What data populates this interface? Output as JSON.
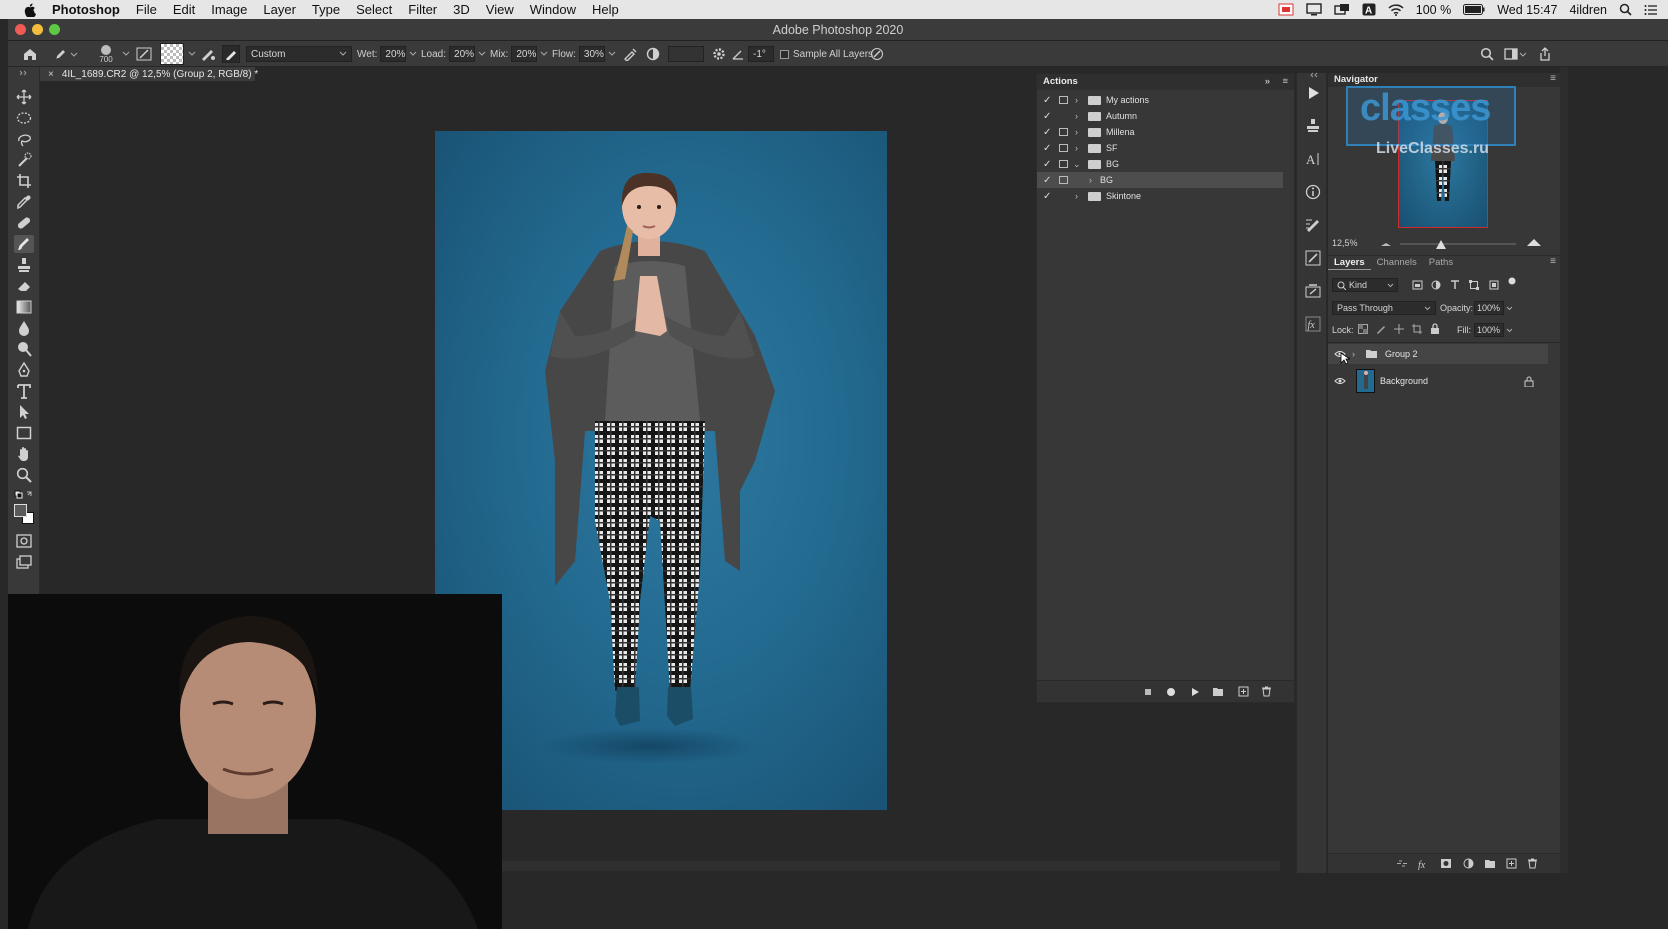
{
  "menubar": {
    "app": "Photoshop",
    "items": [
      "File",
      "Edit",
      "Image",
      "Layer",
      "Type",
      "Select",
      "Filter",
      "3D",
      "View",
      "Window",
      "Help"
    ],
    "battery": "100 %",
    "clock": "Wed 15:47",
    "user": "4ildren"
  },
  "window": {
    "title": "Adobe Photoshop 2020"
  },
  "options": {
    "brush_size": "700",
    "preset": "Custom",
    "wet_label": "Wet:",
    "wet": "20%",
    "load_label": "Load:",
    "load": "20%",
    "mix_label": "Mix:",
    "mix": "20%",
    "flow_label": "Flow:",
    "flow": "30%",
    "angle": "-1°",
    "sample_all_layers": "Sample All Layers"
  },
  "document": {
    "tab": "4IL_1689.CR2 @ 12,5% (Group 2, RGB/8) *"
  },
  "actions": {
    "title": "Actions",
    "items": [
      {
        "label": "My actions",
        "expanded": false
      },
      {
        "label": "Autumn",
        "expanded": false
      },
      {
        "label": "Millena",
        "expanded": false
      },
      {
        "label": "SF",
        "expanded": false
      },
      {
        "label": "BG",
        "expanded": true
      },
      {
        "label": "BG",
        "expanded": false
      },
      {
        "label": "Skintone",
        "expanded": false
      }
    ]
  },
  "navigator": {
    "title": "Navigator",
    "zoom": "12,5%",
    "watermark_top": "classes",
    "watermark": "LiveClasses.ru"
  },
  "layers": {
    "tabs": [
      "Layers",
      "Channels",
      "Paths"
    ],
    "filter_kind": "Kind",
    "blend_mode": "Pass Through",
    "opacity_label": "Opacity:",
    "opacity": "100%",
    "lock_label": "Lock:",
    "fill_label": "Fill:",
    "fill": "100%",
    "items": [
      {
        "name": "Group 2",
        "type": "group",
        "visible": true
      },
      {
        "name": "Background",
        "type": "image",
        "locked": true,
        "visible": true
      }
    ]
  },
  "colors": {
    "accent": "#2b78a4",
    "panel": "#373737",
    "canvas_bg": "#282828"
  }
}
